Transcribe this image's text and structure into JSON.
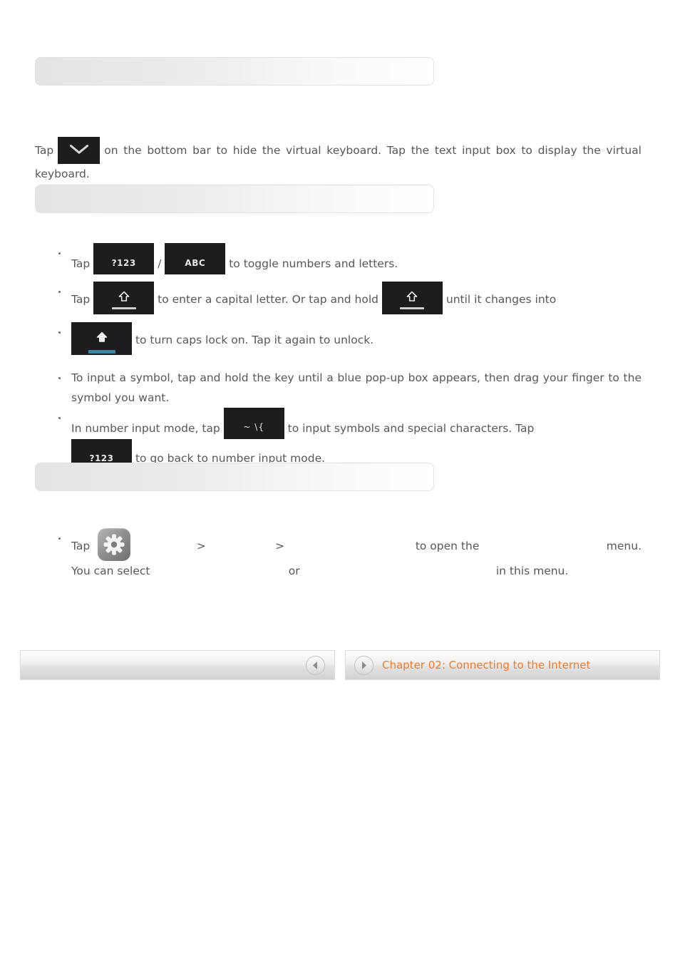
{
  "sections": [
    {
      "title": ""
    },
    {
      "title": ""
    },
    {
      "title": ""
    }
  ],
  "paragraphs": {
    "hide_keyboard": {
      "lead": "Tap",
      "rest": "on the bottom bar to hide the virtual keyboard. Tap the text input box to display the virtual keyboard."
    }
  },
  "keys": {
    "hide_keyboard": "hide-keyboard-key",
    "numbers_mode": "?123",
    "letters_mode": "ABC",
    "shift": "shift-key",
    "shift_hold": "shift-key",
    "caps_lock": "caps-lock-key",
    "symbols": "~ \\{",
    "numbers_back": "?123"
  },
  "bullets_keyboard": [
    {
      "id": "toggle-modes",
      "lead": "Tap",
      "separator": "/",
      "tail": "to toggle numbers and letters."
    },
    {
      "id": "capital-letter",
      "lead": "Tap",
      "mid": "to enter a capital letter. Or tap and hold",
      "tail": "until it changes into"
    },
    {
      "id": "caps-lock",
      "tail": "to turn caps lock on. Tap it again to unlock."
    },
    {
      "id": "symbol-popup",
      "text": "To input a symbol, tap and hold the key until a blue pop-up box appears, then drag your finger to the symbol you want."
    },
    {
      "id": "symbol-input",
      "lead": "In number input mode, tap",
      "mid": "to input symbols and special characters. Tap",
      "tail": "to go back to number input mode."
    }
  ],
  "bullets_settings": [
    {
      "id": "settings-menu",
      "lead": "Tap",
      "ghost_1": "                ",
      "sep_1": ">",
      "ghost_2": "                  ",
      "sep_2": ">",
      "ghost_3": "                                  ",
      "mid_1": "to open the",
      "ghost_4": "                                 ",
      "mid_2": "menu. You can select",
      "ghost_5": "                                    ",
      "mid_3": "or",
      "ghost_6": "                                                   ",
      "mid_4": "in this",
      "tail": "menu."
    }
  ],
  "footer": {
    "prev_label": "",
    "next_label": "Chapter 02: Connecting to the Internet",
    "prev_icon": "chevron-left-icon",
    "next_icon": "chevron-right-icon"
  },
  "colors": {
    "accent_orange": "#f47920",
    "body_text": "#575757",
    "keycap_bg": "#1d1d1f",
    "capslock_indicator": "#2d87a8"
  }
}
